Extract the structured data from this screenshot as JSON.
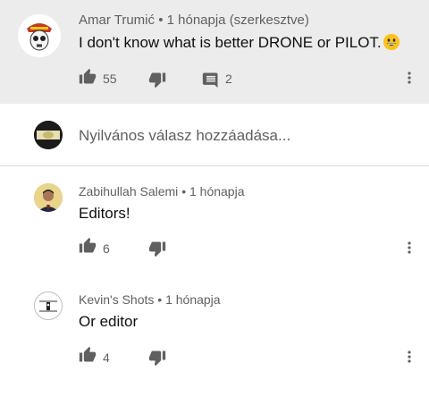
{
  "top_comment": {
    "author": "Amar Trumić",
    "time": "1 hónapja (szerkesztve)",
    "text": "I don't know what is better DRONE or PILOT.",
    "likes": "55",
    "replies": "2"
  },
  "reply_box": {
    "placeholder": "Nyilvános válasz hozzáadása..."
  },
  "replies": [
    {
      "author": "Zabihullah Salemi",
      "time": "1 hónapja",
      "text": "Editors!",
      "likes": "6"
    },
    {
      "author": "Kevin's Shots",
      "time": "1 hónapja",
      "text": "Or editor",
      "likes": "4"
    }
  ],
  "separator": "•",
  "icons": {
    "like": "thumb-up-icon",
    "dislike": "thumb-down-icon",
    "reply": "comment-icon",
    "menu": "more-vert-icon"
  },
  "colors": {
    "highlight_bg": "#ececec",
    "icon": "#606060",
    "meta_text": "#606060"
  }
}
